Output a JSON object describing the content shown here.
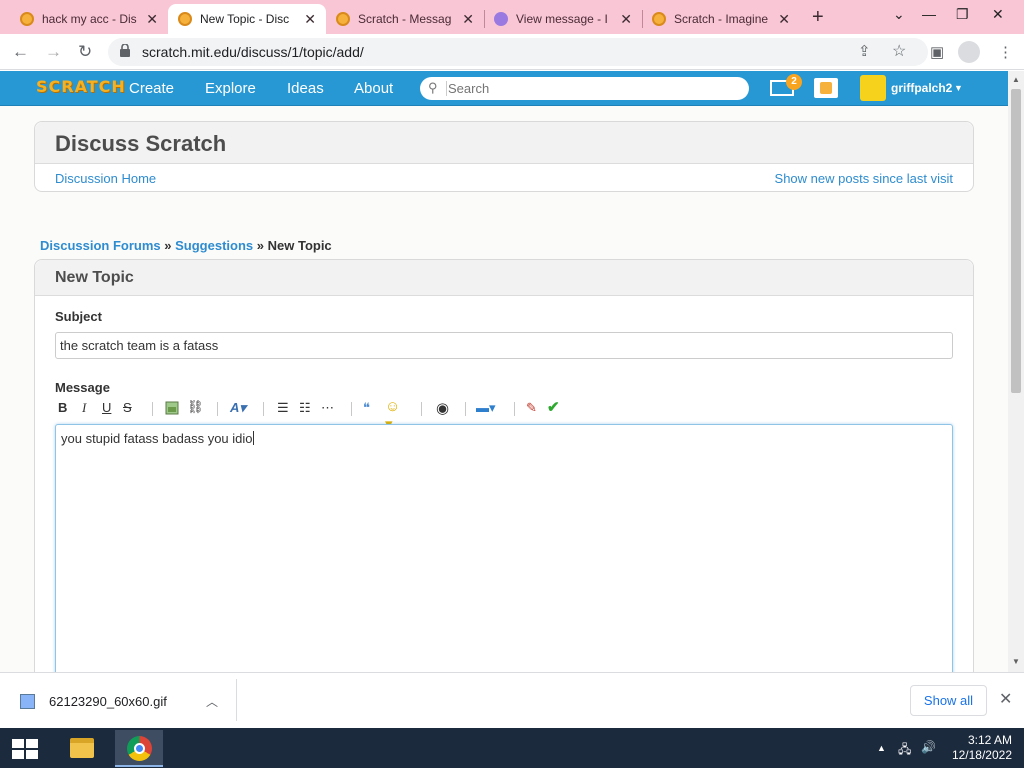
{
  "browser": {
    "tabs": [
      {
        "title": "hack my acc - Dis",
        "icon": "scratch-cat-icon",
        "active": false
      },
      {
        "title": "New Topic - Disc",
        "icon": "scratch-cat-icon",
        "active": true
      },
      {
        "title": "Scratch - Messag",
        "icon": "scratch-cat-icon",
        "active": false
      },
      {
        "title": "View message - I",
        "icon": "mail-service-icon",
        "active": false
      },
      {
        "title": "Scratch - Imagine",
        "icon": "scratch-cat-icon",
        "active": false
      }
    ],
    "url": "scratch.mit.edu/discuss/1/topic/add/"
  },
  "scratch_nav": {
    "logo": "SCRATCH",
    "links": [
      "Create",
      "Explore",
      "Ideas",
      "About"
    ],
    "search_placeholder": "Search",
    "message_count": "2",
    "username": "griffpalch2"
  },
  "discuss": {
    "title": "Discuss Scratch",
    "home_link": "Discussion Home",
    "new_posts_link": "Show new posts since last visit"
  },
  "breadcrumb": {
    "forums": "Discussion Forums",
    "sep": "»",
    "section": "Suggestions",
    "current": "New Topic"
  },
  "form": {
    "heading": "New Topic",
    "subject_label": "Subject",
    "subject_value": "the scratch team is a fatass",
    "message_label": "Message",
    "message_value": "you stupid fatass badass you idio"
  },
  "editor_toolbar": {
    "bold": "B",
    "italic": "I",
    "underline": "U",
    "strike": "S"
  },
  "download_bar": {
    "filename": "62123290_60x60.gif",
    "show_all": "Show all"
  },
  "taskbar": {
    "time": "3:12 AM",
    "date": "12/18/2022"
  },
  "colors": {
    "scratch_blue": "#2798d3",
    "tabstrip_pink": "#f9c6d6",
    "link_blue": "#2e8ccf"
  }
}
